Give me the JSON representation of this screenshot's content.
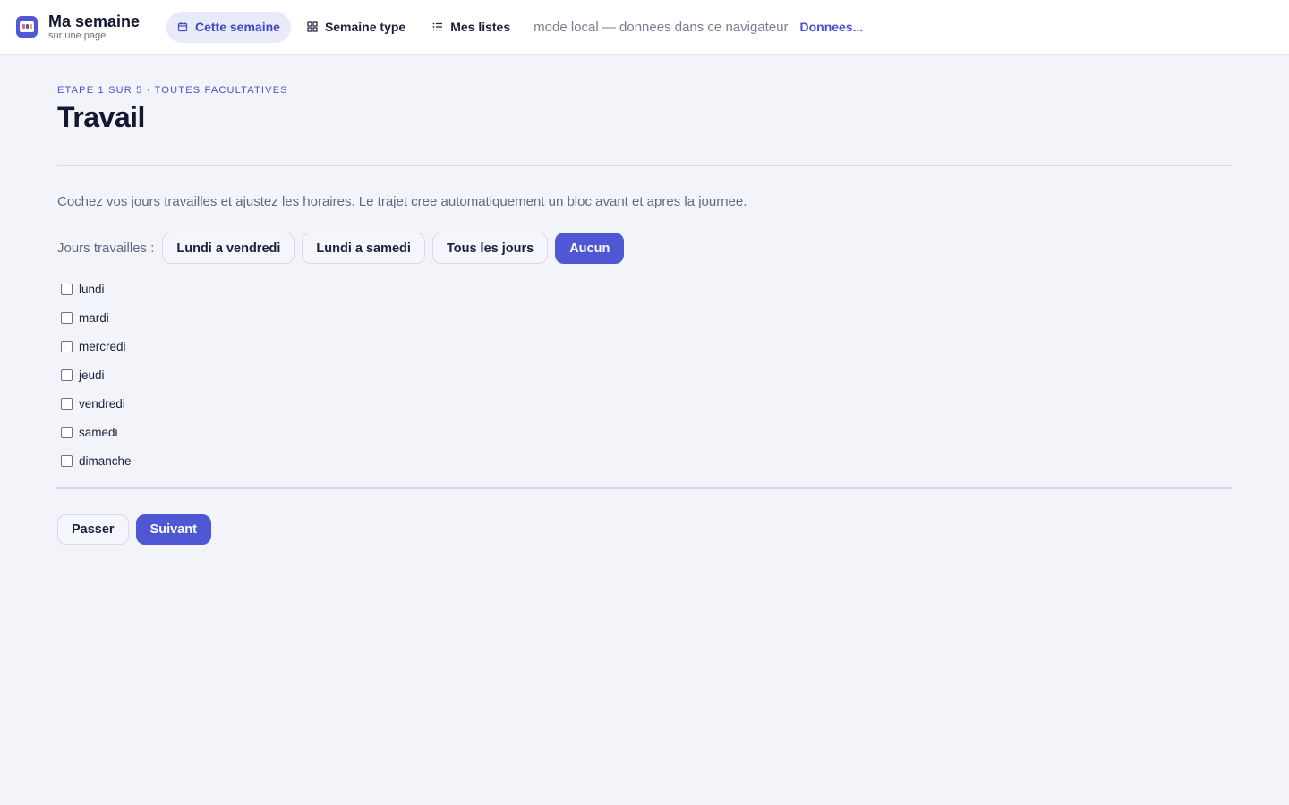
{
  "brand": {
    "title": "Ma semaine",
    "subtitle": "sur une page",
    "icon": "calendar-app-icon"
  },
  "nav": {
    "items": [
      {
        "label": "Cette semaine",
        "icon": "calendar-icon",
        "active": true
      },
      {
        "label": "Semaine type",
        "icon": "grid-icon",
        "active": false
      },
      {
        "label": "Mes listes",
        "icon": "list-icon",
        "active": false
      }
    ],
    "mode_text": "mode local — donnees dans ce navigateur",
    "data_link": "Donnees..."
  },
  "step": {
    "label": "ETAPE 1 SUR 5 · TOUTES FACULTATIVES",
    "title": "Travail",
    "description": "Cochez vos jours travailles et ajustez les horaires. Le trajet cree automatiquement un bloc avant et apres la journee."
  },
  "days_selector": {
    "label": "Jours travailles :",
    "presets": [
      {
        "label": "Lundi a vendredi",
        "selected": false
      },
      {
        "label": "Lundi a samedi",
        "selected": false
      },
      {
        "label": "Tous les jours",
        "selected": false
      },
      {
        "label": "Aucun",
        "selected": true
      }
    ],
    "days": [
      {
        "label": "lundi",
        "checked": false
      },
      {
        "label": "mardi",
        "checked": false
      },
      {
        "label": "mercredi",
        "checked": false
      },
      {
        "label": "jeudi",
        "checked": false
      },
      {
        "label": "vendredi",
        "checked": false
      },
      {
        "label": "samedi",
        "checked": false
      },
      {
        "label": "dimanche",
        "checked": false
      }
    ]
  },
  "actions": {
    "skip_label": "Passer",
    "next_label": "Suivant"
  },
  "colors": {
    "accent": "#4f57d4",
    "background": "#f3f4f9",
    "text": "#1c1f3a"
  }
}
